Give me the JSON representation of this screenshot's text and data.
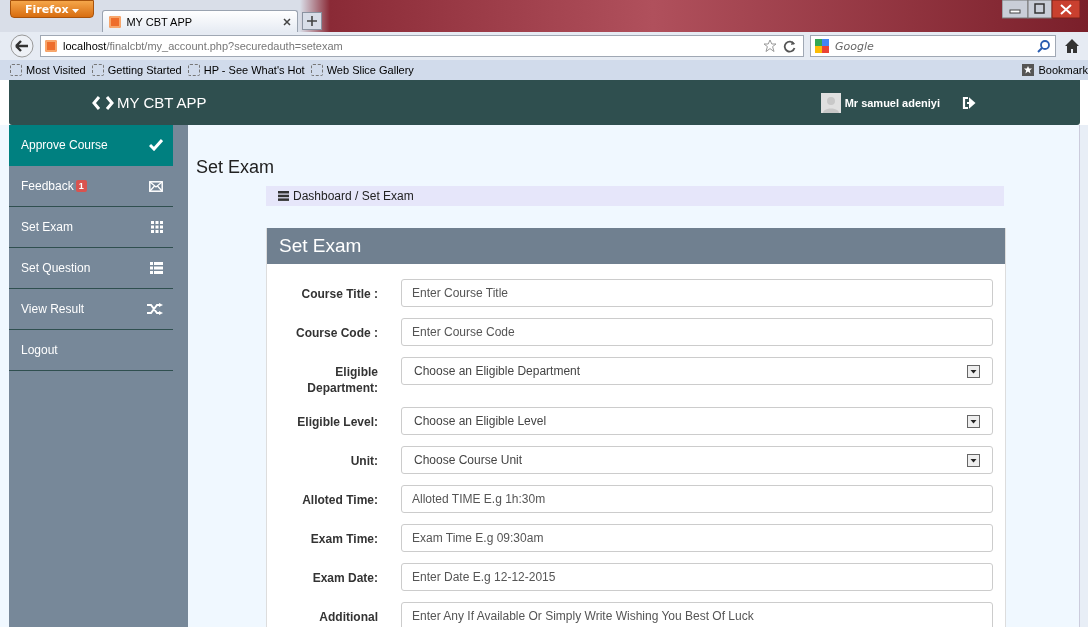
{
  "browser": {
    "menu_button": "Firefox",
    "tab_title": "MY CBT APP",
    "url_host": "localhost",
    "url_path": "/finalcbt/my_account.php?securedauth=setexam",
    "search_placeholder": "Google",
    "bookmarks": [
      "Most Visited",
      "Getting Started",
      "HP - See What's Hot",
      "Web Slice Gallery"
    ],
    "bookmarks_menu": "Bookmark"
  },
  "header": {
    "brand": "MY CBT APP",
    "user_name": "Mr samuel adeniyi"
  },
  "sidebar": {
    "items": [
      {
        "label": "Approve Course",
        "selected": true
      },
      {
        "label": "Feedback",
        "badge": "1",
        "selected": false
      },
      {
        "label": "Set Exam",
        "selected": false
      },
      {
        "label": "Set Question",
        "selected": false
      },
      {
        "label": "View Result",
        "selected": false
      },
      {
        "label": "Logout",
        "selected": false
      }
    ]
  },
  "page_title": "Set Exam",
  "breadcrumb": "Dashboard / Set Exam",
  "form": {
    "title": "Set Exam",
    "fields": [
      {
        "label": "Course Title :",
        "kind": "text",
        "placeholder": "Enter Course Title"
      },
      {
        "label": "Course Code :",
        "kind": "text",
        "placeholder": "Enter Course Code"
      },
      {
        "label": "Eligible Department:",
        "kind": "select",
        "value": "Choose an Eligible Department"
      },
      {
        "label": "Eligible Level:",
        "kind": "select",
        "value": "Choose an Eligible Level"
      },
      {
        "label": "Unit:",
        "kind": "select",
        "value": "Choose Course Unit"
      },
      {
        "label": "Alloted Time:",
        "kind": "text",
        "placeholder": "Alloted TIME E.g 1h:30m"
      },
      {
        "label": "Exam Time:",
        "kind": "text",
        "placeholder": "Exam Time E.g 09:30am"
      },
      {
        "label": "Exam Date:",
        "kind": "text",
        "placeholder": "Enter Date E.g 12-12-2015"
      },
      {
        "label": "Additional",
        "kind": "text",
        "placeholder": "Enter Any If Available Or Simply Write Wishing You Best Of Luck"
      }
    ]
  }
}
